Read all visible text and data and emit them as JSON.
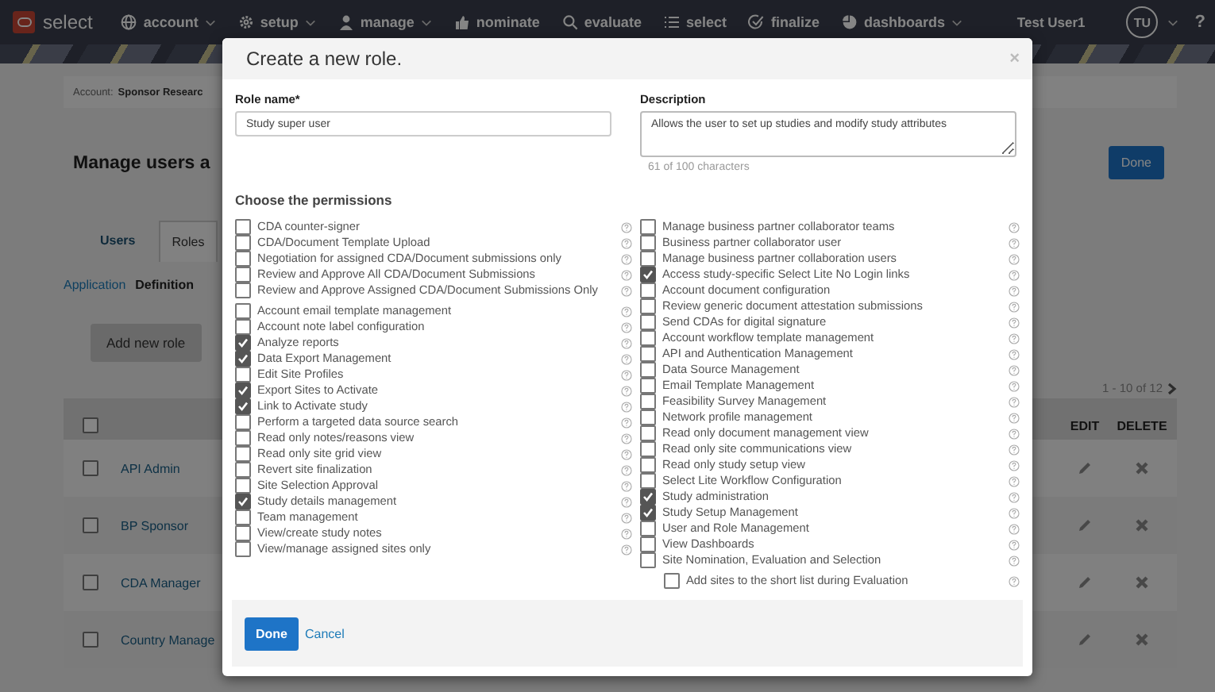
{
  "nav": {
    "logo": "select",
    "items": [
      {
        "label": "account",
        "caret": true
      },
      {
        "label": "setup",
        "caret": true
      },
      {
        "label": "manage",
        "caret": true
      },
      {
        "label": "nominate",
        "caret": false
      },
      {
        "label": "evaluate",
        "caret": false
      },
      {
        "label": "select",
        "caret": false
      },
      {
        "label": "finalize",
        "caret": false
      },
      {
        "label": "dashboards",
        "caret": true
      }
    ],
    "user": "Test User1",
    "avatar": "TU",
    "help": "?"
  },
  "page": {
    "breadcrumb": {
      "label": "Account:",
      "value": "Sponsor Researc"
    },
    "title": "Manage users a",
    "done_button": "Done",
    "tabs": [
      {
        "label": "Users",
        "selected": false
      },
      {
        "label": "Roles",
        "selected": true
      }
    ],
    "subtabs": [
      {
        "label": "Application",
        "selected": false
      },
      {
        "label": "Definition",
        "selected": true
      }
    ],
    "add_button": "Add new role",
    "pagination": "1 - 10 of 12",
    "table": {
      "header_checked": false,
      "columns": [
        "EDIT",
        "DELETE"
      ],
      "rows": [
        {
          "name": "API Admin",
          "checked": false
        },
        {
          "name": "BP Sponsor",
          "checked": false
        },
        {
          "name": "CDA Manager",
          "checked": false
        },
        {
          "name": "Country Manage",
          "checked": false
        }
      ]
    }
  },
  "modal": {
    "title": "Create a new role.",
    "close": "×",
    "role_name": {
      "label": "Role name*",
      "value": "Study super user"
    },
    "description": {
      "label": "Description",
      "value": "Allows the user to set up studies and modify study attributes",
      "counter": "61 of 100 characters"
    },
    "permissions_heading": "Choose the permissions",
    "left_groups": [
      [
        {
          "label": "CDA counter-signer",
          "checked": false
        },
        {
          "label": "CDA/Document Template Upload",
          "checked": false
        },
        {
          "label": "Negotiation for assigned CDA/Document submissions only",
          "checked": false
        },
        {
          "label": "Review and Approve All CDA/Document Submissions",
          "checked": false
        },
        {
          "label": "Review and Approve Assigned CDA/Document Submissions Only",
          "checked": false
        }
      ],
      [
        {
          "label": "Account email template management",
          "checked": false
        },
        {
          "label": "Account note label configuration",
          "checked": false
        },
        {
          "label": "Analyze reports",
          "checked": true
        },
        {
          "label": "Data Export Management",
          "checked": true
        },
        {
          "label": "Edit Site Profiles",
          "checked": false
        },
        {
          "label": "Export Sites to Activate",
          "checked": true
        },
        {
          "label": "Link to Activate study",
          "checked": true
        },
        {
          "label": "Perform a targeted data source search",
          "checked": false
        },
        {
          "label": "Read only notes/reasons view",
          "checked": false
        },
        {
          "label": "Read only site grid view",
          "checked": false
        },
        {
          "label": "Revert site finalization",
          "checked": false
        },
        {
          "label": "Site Selection Approval",
          "checked": false
        },
        {
          "label": "Study details management",
          "checked": true
        },
        {
          "label": "Team management",
          "checked": false
        },
        {
          "label": "View/create study notes",
          "checked": false
        },
        {
          "label": "View/manage assigned sites only",
          "checked": false
        }
      ]
    ],
    "right_items": [
      {
        "label": "Manage business partner collaborator teams",
        "checked": false
      },
      {
        "label": "Business partner collaborator user",
        "checked": false
      },
      {
        "label": "Manage business partner collaboration users",
        "checked": false
      },
      {
        "label": "Access study-specific Select Lite No Login links",
        "checked": true
      },
      {
        "label": "Account document configuration",
        "checked": false
      },
      {
        "label": "Review generic document attestation submissions",
        "checked": false
      },
      {
        "label": "Send CDAs for digital signature",
        "checked": false
      },
      {
        "label": "Account workflow template management",
        "checked": false
      },
      {
        "label": "API and Authentication Management",
        "checked": false
      },
      {
        "label": "Data Source Management",
        "checked": false
      },
      {
        "label": "Email Template Management",
        "checked": false
      },
      {
        "label": "Feasibility Survey Management",
        "checked": false
      },
      {
        "label": "Network profile management",
        "checked": false
      },
      {
        "label": "Read only document management view",
        "checked": false
      },
      {
        "label": "Read only site communications view",
        "checked": false
      },
      {
        "label": "Read only study setup view",
        "checked": false
      },
      {
        "label": "Select Lite Workflow Configuration",
        "checked": false
      },
      {
        "label": "Study administration",
        "checked": true
      },
      {
        "label": "Study Setup Management",
        "checked": true
      },
      {
        "label": "User and Role Management",
        "checked": false
      },
      {
        "label": "View Dashboards",
        "checked": false
      },
      {
        "label": "Site Nomination, Evaluation and Selection",
        "checked": false,
        "children": [
          {
            "label": "Add sites to the short list during Evaluation",
            "checked": false
          }
        ]
      }
    ],
    "done_button": "Done",
    "cancel_link": "Cancel"
  }
}
